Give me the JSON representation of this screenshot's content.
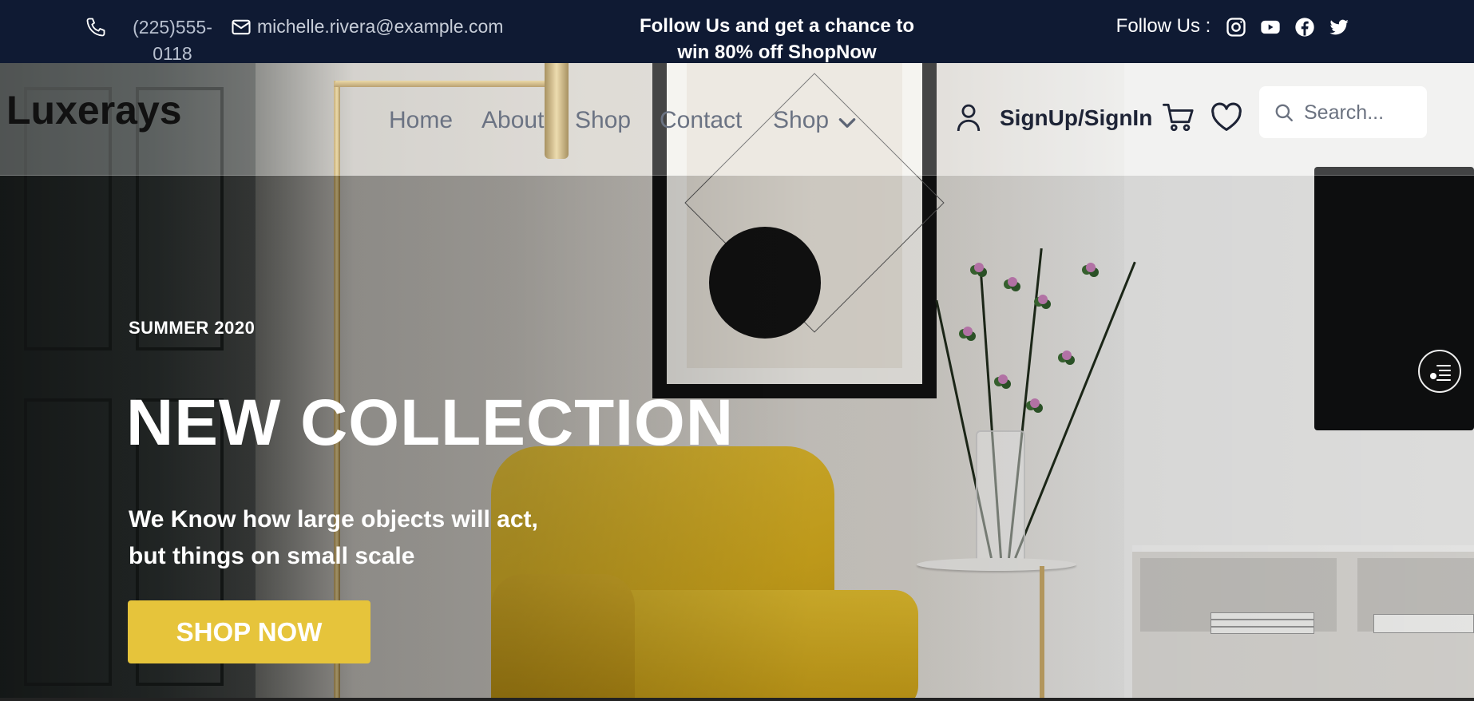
{
  "topbar": {
    "phone": "(225)555-0118",
    "email": "michelle.rivera@example.com",
    "promo": "Follow Us and get a chance to win 80% off ShopNow",
    "follow_label": "Follow Us :",
    "social": [
      "instagram-icon",
      "youtube-icon",
      "facebook-icon",
      "twitter-icon"
    ]
  },
  "header": {
    "logo": "Luxerays",
    "nav": [
      "Home",
      "About",
      "Shop",
      "Contact",
      "Shop"
    ],
    "signin": "SignUp/SignIn",
    "search_placeholder": "Search..."
  },
  "hero": {
    "eyebrow": "SUMMER 2020",
    "title": "NEW COLLECTION",
    "subtitle": "We Know how large objects will act, but things on small scale",
    "cta": "SHOP NOW"
  },
  "colors": {
    "topbar_bg": "#0f1a33",
    "accent": "#e6c43b",
    "nav_text": "#6b7383",
    "dark_text": "#1e2436"
  }
}
